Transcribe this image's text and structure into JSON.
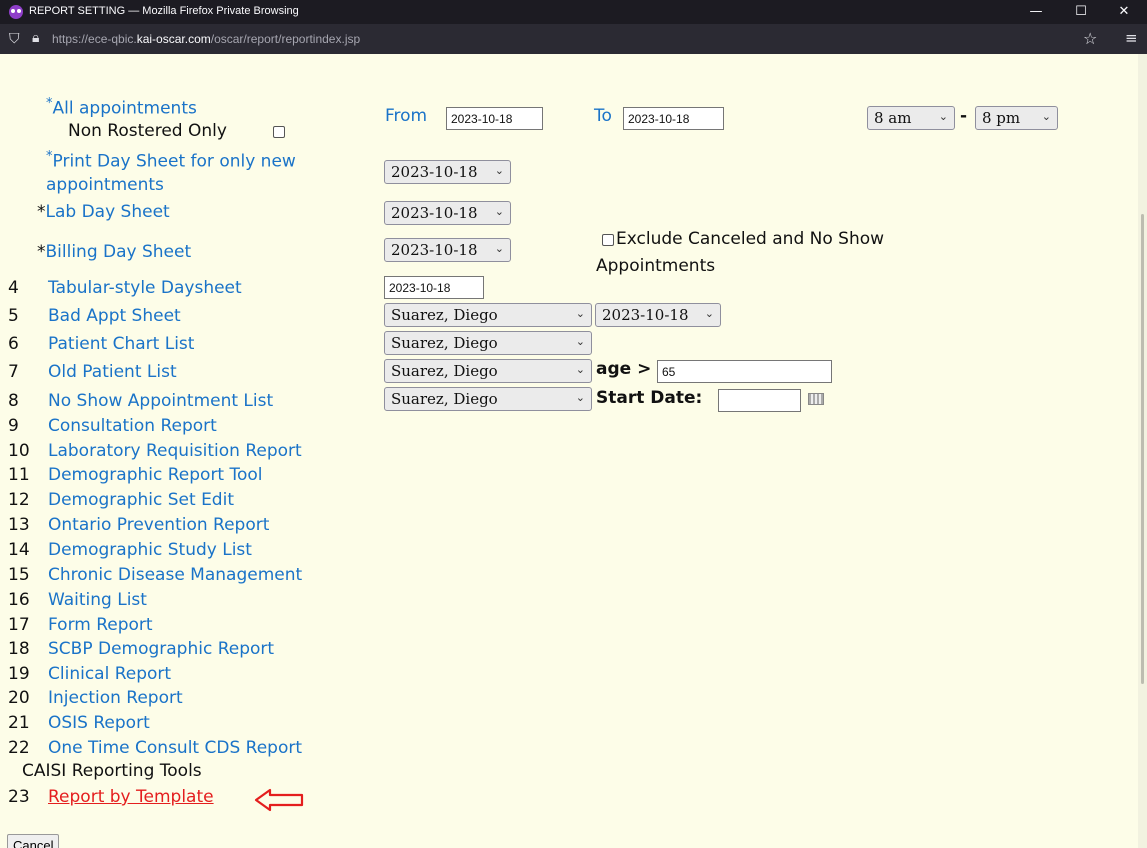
{
  "browser": {
    "window_title": "REPORT SETTING — Mozilla Firefox Private Browsing",
    "url_prefix": "https://ece-qbic.",
    "url_domain": "kai-oscar.com",
    "url_path": "/oscar/report/reportindex.jsp",
    "controls": {
      "minimize": "—",
      "maximize": "☐",
      "close": "✕"
    }
  },
  "top_section": {
    "all_appointments": {
      "star": "*",
      "label": "All appointments"
    },
    "non_rostered_only": "Non Rostered Only",
    "from_label": "From",
    "from_value": "2023-10-18",
    "to_label": "To",
    "to_value": "2023-10-18",
    "time_start": "8 am",
    "time_dash": "-",
    "time_end": "8 pm",
    "print_day_sheet": {
      "star": "*",
      "line1": "Print Day Sheet for only new",
      "line2": "appointments"
    },
    "print_day_sheet_date": "2023-10-18",
    "lab_day_sheet": {
      "star": "*",
      "label": "Lab Day Sheet"
    },
    "lab_day_sheet_date": "2023-10-18",
    "billing_day_sheet": {
      "star": "*",
      "label": "Billing Day Sheet"
    },
    "billing_day_sheet_date": "2023-10-18",
    "exclude_line1": "Exclude Canceled and No Show",
    "exclude_line2": "Appointments"
  },
  "reports": [
    {
      "num": "4",
      "label": "Tabular-style Daysheet"
    },
    {
      "num": "5",
      "label": "Bad Appt Sheet"
    },
    {
      "num": "6",
      "label": "Patient Chart List"
    },
    {
      "num": "7",
      "label": "Old Patient List"
    },
    {
      "num": "8",
      "label": "No Show Appointment List"
    },
    {
      "num": "9",
      "label": "Consultation Report"
    },
    {
      "num": "10",
      "label": "Laboratory Requisition Report"
    },
    {
      "num": "11",
      "label": "Demographic Report Tool"
    },
    {
      "num": "12",
      "label": "Demographic Set Edit"
    },
    {
      "num": "13",
      "label": "Ontario Prevention Report"
    },
    {
      "num": "14",
      "label": "Demographic Study List"
    },
    {
      "num": "15",
      "label": "Chronic Disease Management"
    },
    {
      "num": "16",
      "label": "Waiting List"
    },
    {
      "num": "17",
      "label": "Form Report"
    },
    {
      "num": "18",
      "label": "SCBP Demographic Report"
    },
    {
      "num": "19",
      "label": "Clinical Report"
    },
    {
      "num": "20",
      "label": "Injection Report"
    },
    {
      "num": "21",
      "label": "OSIS Report"
    },
    {
      "num": "22",
      "label": "One Time Consult CDS Report"
    }
  ],
  "caisi_heading": "CAISI Reporting Tools",
  "report_by_template": {
    "num": "23",
    "label": "Report by Template"
  },
  "controls": {
    "tabular_date": "2023-10-18",
    "bad_appt_provider": "Suarez, Diego",
    "bad_appt_date": "2023-10-18",
    "patient_chart_provider": "Suarez, Diego",
    "old_patient_provider": "Suarez, Diego",
    "age_label": "age >",
    "age_value": "65",
    "no_show_provider": "Suarez, Diego",
    "start_date_label": "Start Date:",
    "start_date_value": ""
  },
  "cancel_label": "Cancel",
  "colors": {
    "link": "#1a73c8",
    "highlight_link": "#e41e1e",
    "arrow": "#e41e1e",
    "background": "#fdfde8"
  }
}
